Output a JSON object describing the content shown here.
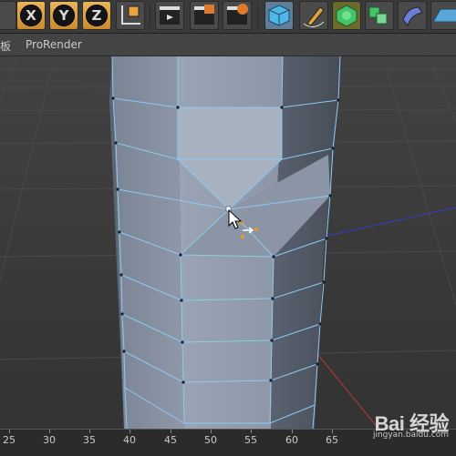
{
  "toolbar": {
    "axis_x": "X",
    "axis_y": "Y",
    "axis_z": "Z"
  },
  "menubar": {
    "panel_label": "面板",
    "prorender_label": "ProRender"
  },
  "timeline": {
    "ticks": [
      "25",
      "30",
      "35",
      "40",
      "45",
      "50",
      "55",
      "60",
      "65"
    ]
  },
  "watermark": {
    "logo_text": "Bai 经验",
    "sub_text": "jingyan.baidu.com"
  },
  "colors": {
    "selection_edge": "#8ccaf2",
    "point": "#1a1a2a",
    "x_axis": "#b03a3a",
    "y_axis": "#3b3bd0",
    "accent": "#e9b45a"
  }
}
